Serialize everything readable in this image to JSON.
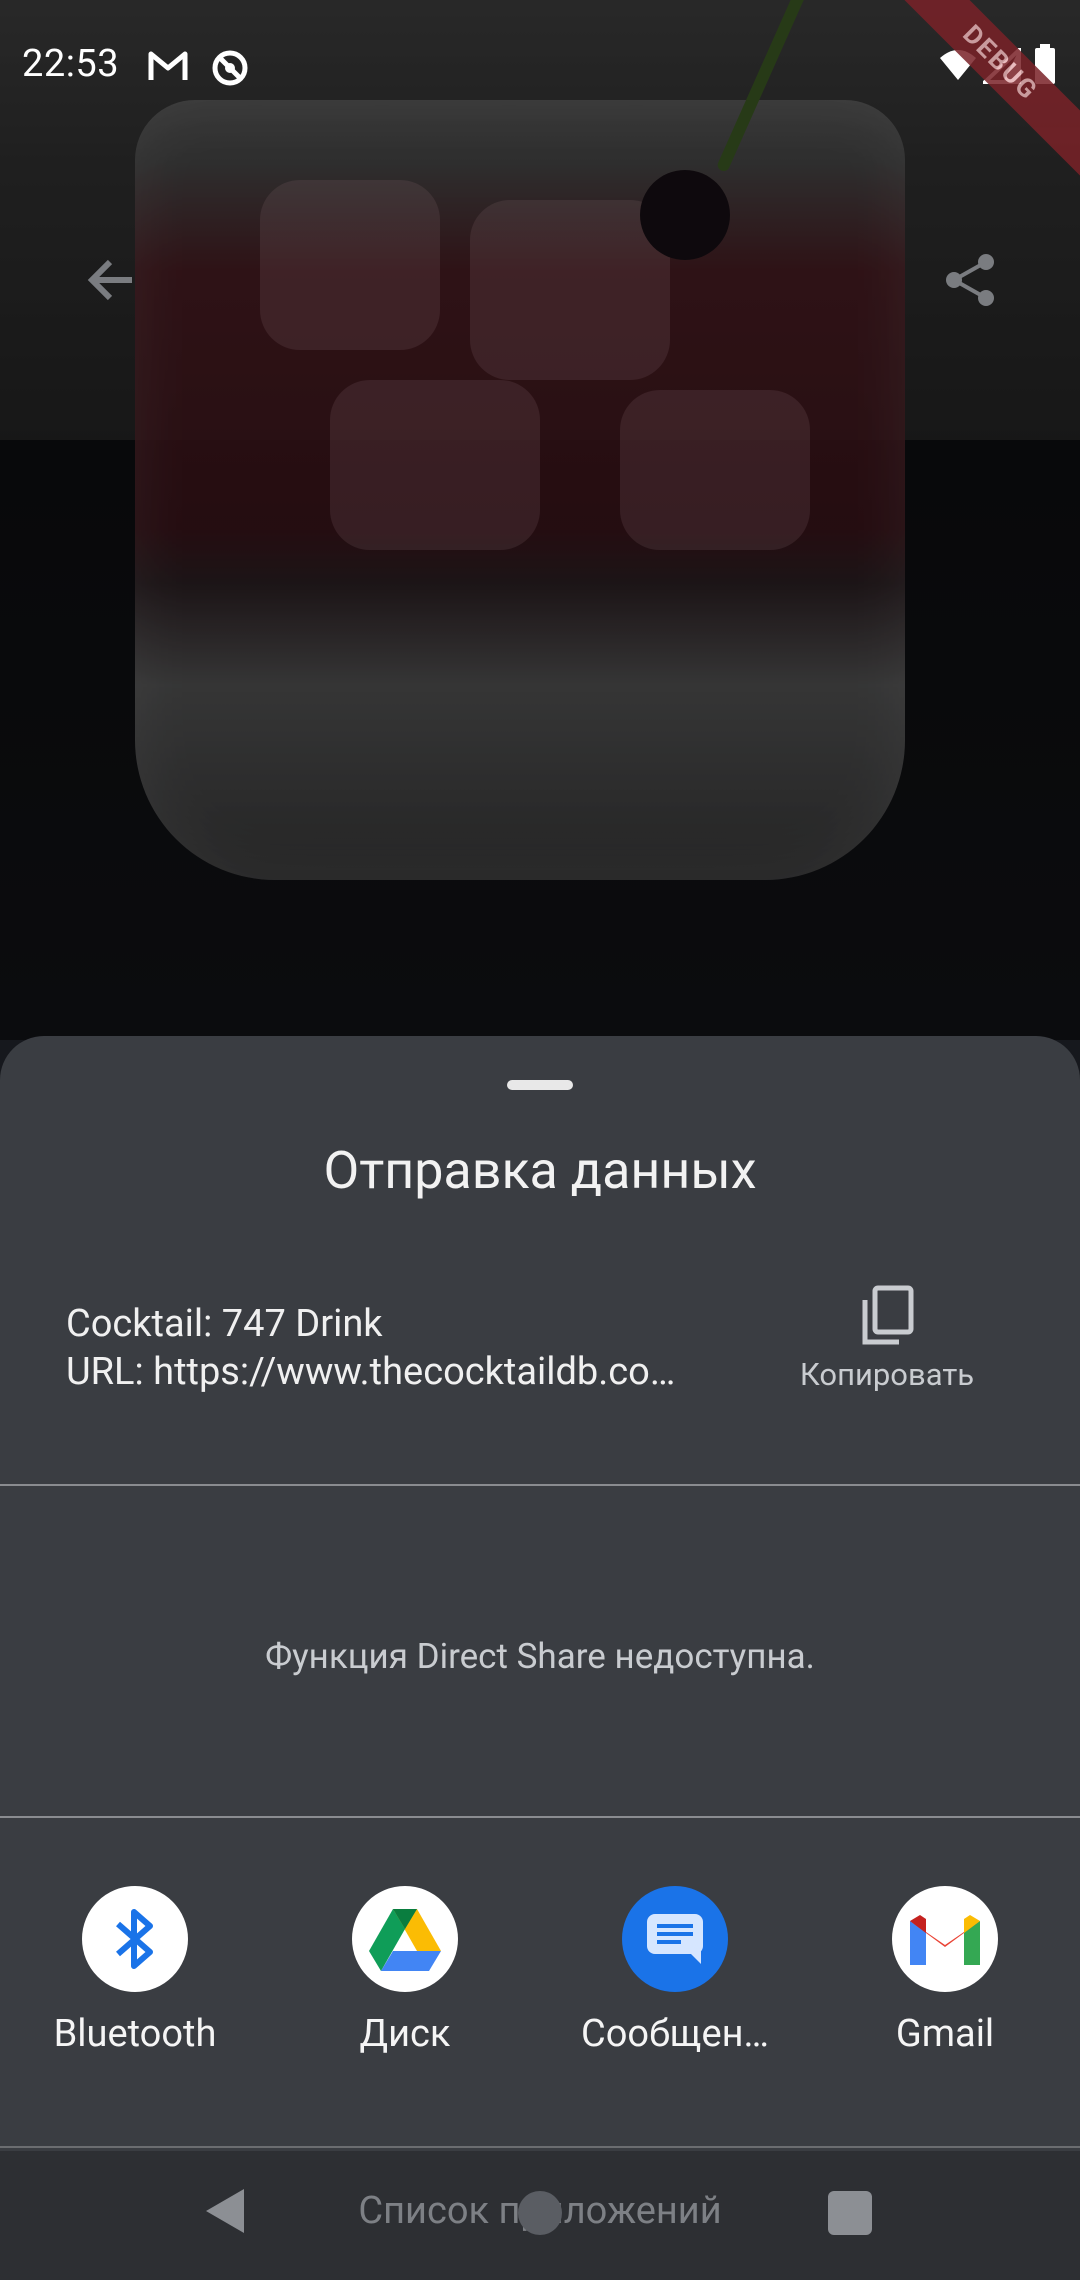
{
  "status_bar": {
    "time": "22:53",
    "icons": [
      "gmail-icon",
      "sync-icon",
      "wifi-icon",
      "signal-icon",
      "battery-icon"
    ]
  },
  "debug_banner": "DEBUG",
  "app_bar": {
    "back_icon": "arrow-back-icon",
    "share_icon": "share-icon"
  },
  "share_sheet": {
    "title": "Отправка данных",
    "preview_line1": "Cocktail: 747 Drink",
    "preview_line2": "URL: https://www.thecocktaildb.co…",
    "copy_label": "Копировать",
    "direct_share_message": "Функция Direct Share недоступна.",
    "apps": [
      {
        "label": "Bluetooth",
        "icon": "bluetooth-icon",
        "color": "#1a73e8"
      },
      {
        "label": "Диск",
        "icon": "google-drive-icon",
        "color": "#34a853"
      },
      {
        "label": "Сообщен…",
        "icon": "messages-icon",
        "color": "#1a73e8"
      },
      {
        "label": "Gmail",
        "icon": "gmail-icon",
        "color": "#ea4335"
      }
    ]
  },
  "navigation_bar": {
    "apps_list_label": "Список приложений"
  },
  "colors": {
    "sheet_background": "#3a3d42",
    "nav_background": "#2d2f33",
    "debug_banner": "#7a2228"
  }
}
